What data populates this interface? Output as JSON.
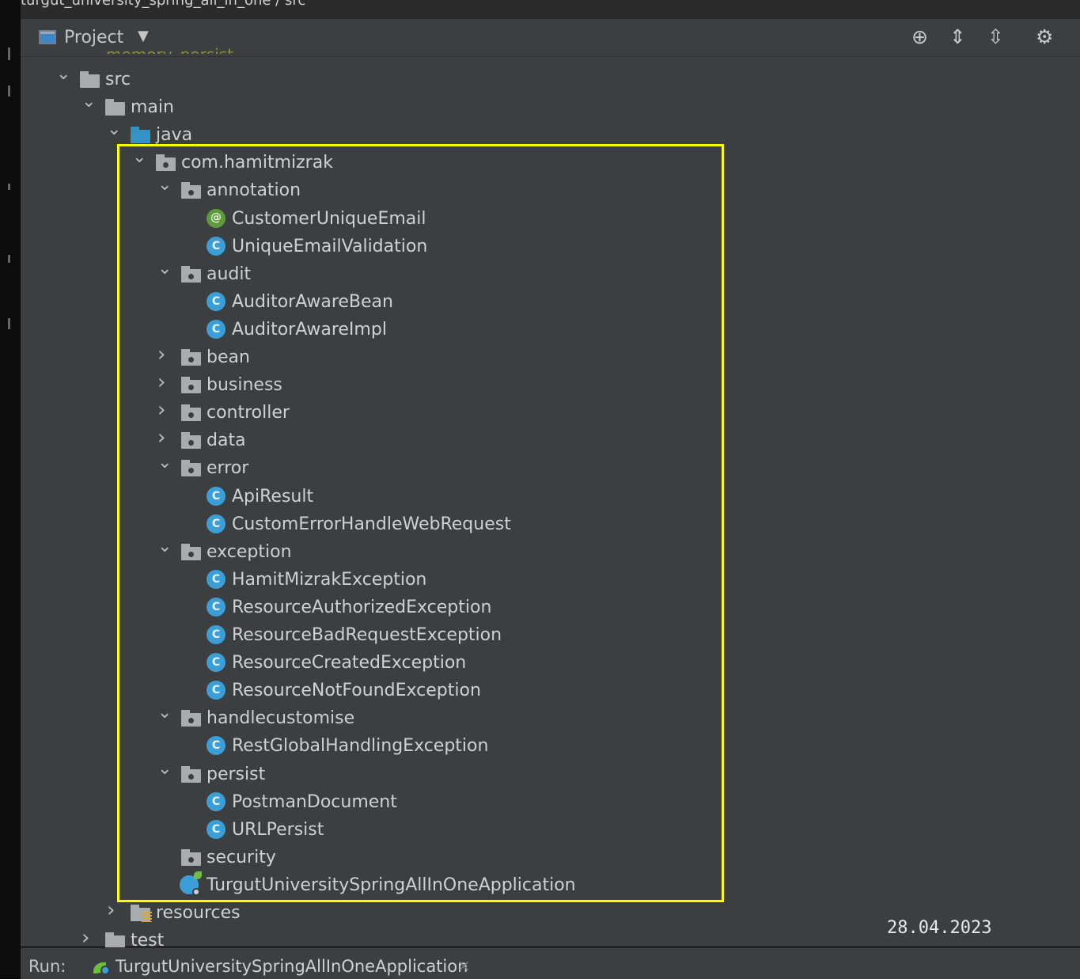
{
  "breadcrumb": {
    "text": "turgut_university_spring_all_in_one / src"
  },
  "header": {
    "title": "Project",
    "dropdown_icon": "▼",
    "actions": [
      {
        "name": "locate-icon",
        "glyph": "⊕"
      },
      {
        "name": "expand-all-icon",
        "glyph": "⇕"
      },
      {
        "name": "collapse-all-icon",
        "glyph": "⇳"
      },
      {
        "name": "settings-icon",
        "glyph": "⚙"
      }
    ]
  },
  "tree": {
    "partial_top_item": "memory_persist",
    "rows": [
      {
        "label": "src",
        "chevron": "open",
        "icon": "folder-plain",
        "level": 0
      },
      {
        "label": "main",
        "chevron": "open",
        "icon": "folder-plain",
        "level": 1
      },
      {
        "label": "java",
        "chevron": "open",
        "icon": "folder-blue",
        "level": 2
      },
      {
        "label": "com.hamitmizrak",
        "chevron": "open",
        "icon": "package",
        "level": 3
      },
      {
        "label": "annotation",
        "chevron": "open",
        "icon": "package",
        "level": 4
      },
      {
        "label": "CustomerUniqueEmail",
        "chevron": "none",
        "icon": "annotation",
        "level": 5
      },
      {
        "label": "UniqueEmailValidation",
        "chevron": "none",
        "icon": "class",
        "level": 5
      },
      {
        "label": "audit",
        "chevron": "open",
        "icon": "package",
        "level": 4
      },
      {
        "label": "AuditorAwareBean",
        "chevron": "none",
        "icon": "class",
        "level": 5
      },
      {
        "label": "AuditorAwareImpl",
        "chevron": "none",
        "icon": "class",
        "level": 5
      },
      {
        "label": "bean",
        "chevron": "closed",
        "icon": "package",
        "level": 4
      },
      {
        "label": "business",
        "chevron": "closed",
        "icon": "package",
        "level": 4
      },
      {
        "label": "controller",
        "chevron": "closed",
        "icon": "package",
        "level": 4
      },
      {
        "label": "data",
        "chevron": "closed",
        "icon": "package",
        "level": 4
      },
      {
        "label": "error",
        "chevron": "open",
        "icon": "package",
        "level": 4
      },
      {
        "label": "ApiResult",
        "chevron": "none",
        "icon": "class",
        "level": 5
      },
      {
        "label": "CustomErrorHandleWebRequest",
        "chevron": "none",
        "icon": "class",
        "level": 5
      },
      {
        "label": "exception",
        "chevron": "open",
        "icon": "package",
        "level": 4
      },
      {
        "label": "HamitMizrakException",
        "chevron": "none",
        "icon": "class",
        "level": 5
      },
      {
        "label": "ResourceAuthorizedException",
        "chevron": "none",
        "icon": "class",
        "level": 5
      },
      {
        "label": "ResourceBadRequestException",
        "chevron": "none",
        "icon": "class",
        "level": 5
      },
      {
        "label": "ResourceCreatedException",
        "chevron": "none",
        "icon": "class",
        "level": 5
      },
      {
        "label": "ResourceNotFoundException",
        "chevron": "none",
        "icon": "class",
        "level": 5
      },
      {
        "label": "handlecustomise",
        "chevron": "open",
        "icon": "package",
        "level": 4
      },
      {
        "label": "RestGlobalHandlingException",
        "chevron": "none",
        "icon": "class",
        "level": 5
      },
      {
        "label": "persist",
        "chevron": "open",
        "icon": "package",
        "level": 4
      },
      {
        "label": "PostmanDocument",
        "chevron": "none",
        "icon": "class",
        "level": 5
      },
      {
        "label": "URLPersist",
        "chevron": "none",
        "icon": "class",
        "level": 5
      },
      {
        "label": "security",
        "chevron": "none",
        "icon": "package",
        "level": 4
      },
      {
        "label": "TurgutUniversitySpringAllInOneApplication",
        "chevron": "none",
        "icon": "spring-app",
        "level": 4
      },
      {
        "label": "resources",
        "chevron": "closed",
        "icon": "folder-res",
        "level": 2
      },
      {
        "label": "test",
        "chevron": "closed",
        "icon": "folder-plain",
        "level": 1
      }
    ]
  },
  "overlay": {
    "date": "28.04.2023",
    "highlight_color": "#ffff00"
  },
  "run_bar": {
    "label": "Run:",
    "app": "TurgutUniversitySpringAllInOneApplication",
    "close": "×"
  },
  "colors": {
    "panel": "#3c3f41",
    "class_icon": "#3c9ed6",
    "annotation_icon": "#5d9b3c",
    "java_folder": "#3592c4"
  }
}
